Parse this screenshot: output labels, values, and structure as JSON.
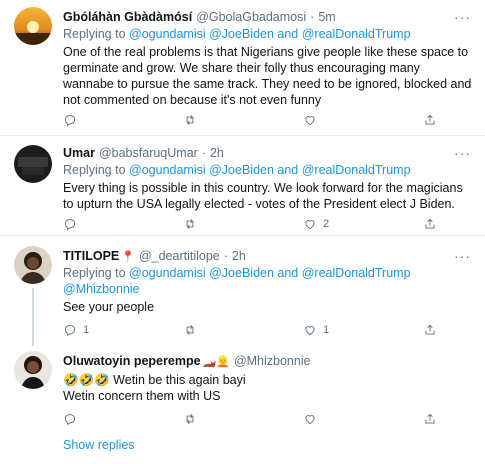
{
  "tweets": [
    {
      "name": "Gbóláhàn Gbàdàmósí",
      "handle": "@GbolaGbadamosi",
      "dot": "·",
      "time": "5m",
      "replying_prefix": "Replying to",
      "replying_to": "@ogundamisi @JoeBiden and @realDonaldTrump",
      "text": "One of the real problems is that Nigerians give people like these space to germinate and grow. We share their folly thus encouraging many wannabe to pursue the same track. They need to be ignored, blocked and not commented on because it's not even funny",
      "reply_count": "",
      "retweet_count": "",
      "like_count": ""
    },
    {
      "name": "Umar",
      "handle": "@babsfaruqUmar",
      "dot": "·",
      "time": "2h",
      "replying_prefix": "Replying to",
      "replying_to": "@ogundamisi @JoeBiden and @realDonaldTrump",
      "text": "Every thing is possible in this country. We look forward for the magicians to upturn the USA legally elected - votes of the President elect J Biden.",
      "reply_count": "",
      "retweet_count": "",
      "like_count": "2"
    },
    {
      "name": "TITILOPE",
      "name_emoji": "📍",
      "handle": "@_deartitilope",
      "dot": "·",
      "time": "2h",
      "replying_prefix": "Replying to",
      "replying_to": "@ogundamisi @JoeBiden and @realDonaldTrump",
      "replying_to_line2": "@Mhizbonnie",
      "text": "See your people",
      "reply_count": "1",
      "retweet_count": "",
      "like_count": "1"
    },
    {
      "name": "Oluwatoyin peperempe",
      "name_emoji": "🏎️👱",
      "handle": "@Mhizbonnie",
      "text_line1": "🤣🤣🤣 Wetin be this again bayi",
      "text_line2": "Wetin concern them with US",
      "reply_count": "",
      "retweet_count": "",
      "like_count": ""
    }
  ],
  "show_replies": "Show replies",
  "colors": {
    "link": "#1b95e0",
    "secondary": "#5b7083",
    "divider": "#e6ecf0"
  }
}
